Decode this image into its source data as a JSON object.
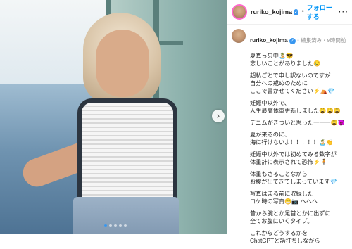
{
  "account": {
    "username": "ruriko_kojima",
    "verified_mark": "✓",
    "separator": "•",
    "follow_label": "フォローする",
    "more_label": "···"
  },
  "caption": {
    "author": "ruriko_kojima",
    "edited_meta": "・編集済み・9時間前",
    "paragraphs": [
      "夏真っ只中🏝️😎\n悲しいことがありました😢",
      "超私ごとで申し訳ないのですが\n自分への戒めのために\nここで書かせてください⚡️⛺️💎",
      "妊娠中以外で、\n人生最高体重更新しました😩😩😩",
      "デニムがきついと思った一一一😩👿",
      "夏が来るのに、\n海に行けないよ！！！！！🏝️👏",
      "妊娠中以外では初めてみる数字が\n体重計に表示されて恐怖⚡️🧍",
      "体重もさることながら\nお腹が出てきてしまっています💎",
      "写真はまる前に収録した\nロケ時の写真😁📷 へへへ",
      "昔から腕とか足首とかに出ずに\n全てお腹にいくタイプ。",
      "これからどうするかを\nChatGPTと話打ちしながら"
    ]
  },
  "carousel": {
    "next_icon": "chevron-right-icon",
    "next_glyph": "›",
    "dot_count": 5,
    "active_dot": 0
  },
  "colors": {
    "link": "#0095f6",
    "verified": "#3897f0"
  }
}
